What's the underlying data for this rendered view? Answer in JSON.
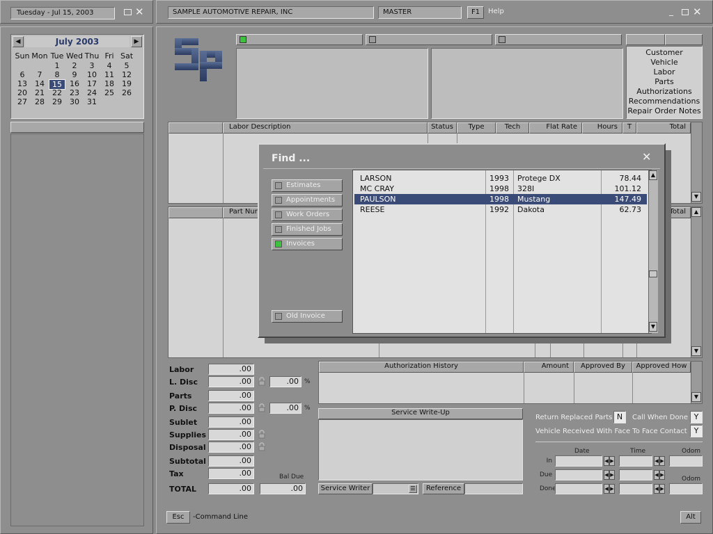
{
  "left": {
    "date_label": "Tuesday - Jul 15, 2003",
    "calendar": {
      "month_title": "July  2003",
      "weekdays": [
        "Sun",
        "Mon",
        "Tue",
        "Wed",
        "Thu",
        "Fri",
        "Sat"
      ],
      "weeks": [
        [
          "",
          "",
          "1",
          "2",
          "3",
          "4",
          "5"
        ],
        [
          "6",
          "7",
          "8",
          "9",
          "10",
          "11",
          "12"
        ],
        [
          "13",
          "14",
          "15",
          "16",
          "17",
          "18",
          "19"
        ],
        [
          "20",
          "21",
          "22",
          "23",
          "24",
          "25",
          "26"
        ],
        [
          "27",
          "28",
          "29",
          "30",
          "31",
          "",
          ""
        ]
      ],
      "selected": "15"
    }
  },
  "top": {
    "company": "SAMPLE AUTOMOTIVE REPAIR, INC",
    "user": "MASTER",
    "f1": "F1",
    "help": "Help"
  },
  "customer_menu": [
    "Customer",
    "Vehicle",
    "Labor",
    "Parts",
    "Authorizations",
    "Recommendations",
    "Repair Order Notes"
  ],
  "labor_table": {
    "headers": [
      "Labor  Description",
      "Status",
      "Type",
      "Tech",
      "Flat Rate",
      "Hours",
      "T",
      "Total"
    ]
  },
  "parts_table": {
    "headers": [
      "Part  Num",
      "Total"
    ]
  },
  "find_dialog": {
    "title": "Find ...",
    "buttons": [
      {
        "label": "Estimates",
        "checked": false
      },
      {
        "label": "Appointments",
        "checked": false
      },
      {
        "label": "Work Orders",
        "checked": false
      },
      {
        "label": "Finished Jobs",
        "checked": false
      },
      {
        "label": "Invoices",
        "checked": true
      }
    ],
    "old_invoice": "Old Invoice",
    "rows": [
      {
        "name": "LARSON",
        "year": "1993",
        "model": "Protege DX",
        "amount": "78.44",
        "selected": false
      },
      {
        "name": "MC CRAY",
        "year": "1998",
        "model": "328I",
        "amount": "101.12",
        "selected": false
      },
      {
        "name": "PAULSON",
        "year": "1998",
        "model": "Mustang",
        "amount": "147.49",
        "selected": true
      },
      {
        "name": "REESE",
        "year": "1992",
        "model": "Dakota",
        "amount": "62.73",
        "selected": false
      }
    ]
  },
  "totals": {
    "labor": {
      "label": "Labor",
      "value": ".00"
    },
    "l_disc": {
      "label": "L. Disc",
      "value": ".00",
      "pct": ".00"
    },
    "parts": {
      "label": "Parts",
      "value": ".00"
    },
    "p_disc": {
      "label": "P. Disc",
      "value": ".00",
      "pct": ".00"
    },
    "sublet": {
      "label": "Sublet",
      "value": ".00"
    },
    "supplies": {
      "label": "Supplies",
      "value": ".00"
    },
    "disposal": {
      "label": "Disposal",
      "value": ".00"
    },
    "subtotal": {
      "label": "Subtotal",
      "value": ".00"
    },
    "tax": {
      "label": "Tax",
      "value": ".00"
    },
    "total": {
      "label": "TOTAL",
      "value": ".00"
    },
    "bal_due_label": "Bal Due",
    "bal_due": ".00",
    "pct_sign": "%"
  },
  "auth_table": {
    "headers": [
      "Authorization  History",
      "Amount",
      "Approved By",
      "Approved How"
    ]
  },
  "service": {
    "writeup_label": "Service  Write-Up",
    "writer_label": "Service Writer",
    "reference_label": "Reference"
  },
  "options": {
    "return_parts_label": "Return Replaced Parts",
    "return_parts_value": "N",
    "call_done_label": "Call When Done",
    "call_done_value": "Y",
    "face_label": "Vehicle Received With Face To Face Contact",
    "face_value": "Y"
  },
  "schedule": {
    "date_label": "Date",
    "time_label": "Time",
    "odom_label": "Odom",
    "rows": [
      "In",
      "Due",
      "Done"
    ]
  },
  "bottom": {
    "esc": "Esc",
    "command_line": "-Command Line",
    "alt": "Alt"
  }
}
